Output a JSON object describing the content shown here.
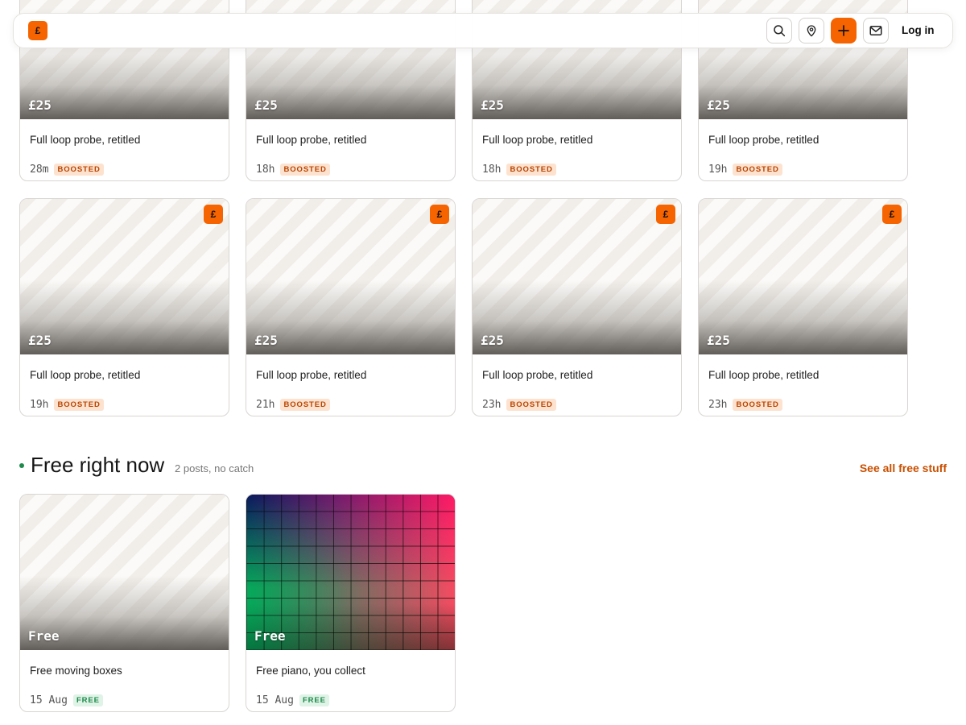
{
  "header": {
    "logo": "£",
    "login_label": "Log in"
  },
  "listings": {
    "row1": [
      {
        "price": "£25",
        "title": "Full loop probe, retitled",
        "time": "28m",
        "tag": "BOOSTED"
      },
      {
        "price": "£25",
        "title": "Full loop probe, retitled",
        "time": "18h",
        "tag": "BOOSTED"
      },
      {
        "price": "£25",
        "title": "Full loop probe, retitled",
        "time": "18h",
        "tag": "BOOSTED"
      },
      {
        "price": "£25",
        "title": "Full loop probe, retitled",
        "time": "19h",
        "tag": "BOOSTED"
      }
    ],
    "row2": [
      {
        "badge": "£",
        "price": "£25",
        "title": "Full loop probe, retitled",
        "time": "19h",
        "tag": "BOOSTED"
      },
      {
        "badge": "£",
        "price": "£25",
        "title": "Full loop probe, retitled",
        "time": "21h",
        "tag": "BOOSTED"
      },
      {
        "badge": "£",
        "price": "£25",
        "title": "Full loop probe, retitled",
        "time": "23h",
        "tag": "BOOSTED"
      },
      {
        "badge": "£",
        "price": "£25",
        "title": "Full loop probe, retitled",
        "time": "23h",
        "tag": "BOOSTED"
      }
    ]
  },
  "free_section": {
    "title": "Free right now",
    "subtitle": "2 posts, no catch",
    "link": "See all free stuff",
    "items": [
      {
        "price": "Free",
        "title": "Free moving boxes",
        "date": "15 Aug",
        "tag": "FREE"
      },
      {
        "price": "Free",
        "title": "Free piano, you collect",
        "date": "15 Aug",
        "tag": "FREE"
      }
    ]
  },
  "colors": {
    "accent": "#f56400",
    "boosted_bg": "#fde3cf",
    "boosted_text": "#b84300",
    "free_bg": "#dff3e6",
    "free_text": "#1e8a4c",
    "link": "#c84f00"
  },
  "icons": [
    "search-icon",
    "location-pin-icon",
    "plus-icon",
    "mail-icon"
  ]
}
